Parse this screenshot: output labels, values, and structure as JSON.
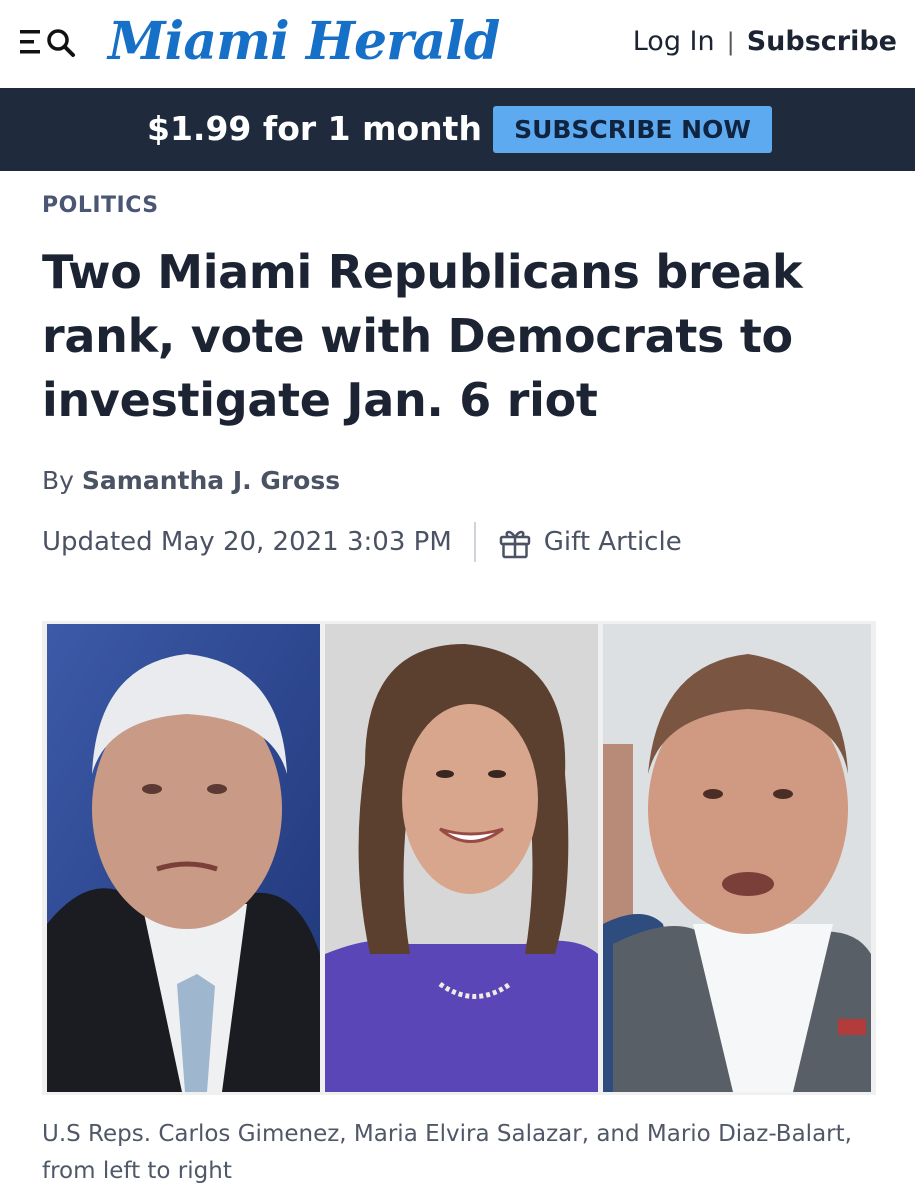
{
  "header": {
    "logo_text": "Miami Herald",
    "menu_icon": "menu-icon",
    "search_icon": "search-icon",
    "login_label": "Log In",
    "separator": "|",
    "subscribe_label": "Subscribe"
  },
  "promo": {
    "price_text": "$1.99 for 1 month",
    "button_label": "SUBSCRIBE NOW"
  },
  "article": {
    "section": "POLITICS",
    "headline": "Two Miami Republicans break rank, vote with Democrats to investigate Jan. 6 riot",
    "byline_prefix": "By",
    "author": "Samantha J. Gross",
    "updated": "Updated May 20, 2021 3:03 PM",
    "gift_icon": "gift-icon",
    "gift_label": "Gift Article",
    "photo_caption": "U.S Reps. Carlos Gimenez, Maria Elvira Salazar, and Mario Diaz-Balart, from left to right"
  },
  "colors": {
    "brand_blue": "#1670c8",
    "promo_bg": "#1f2a3c",
    "promo_button": "#5eaaf0",
    "text_dark": "#1c2433",
    "text_muted": "#4a5263"
  }
}
